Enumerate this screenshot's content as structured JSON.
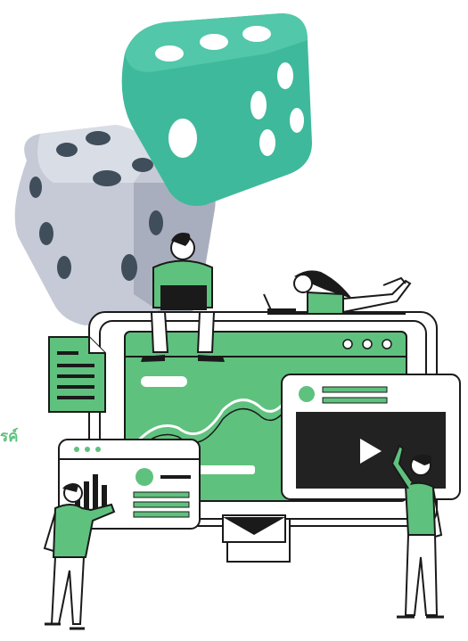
{
  "side_text": "รค์",
  "colors": {
    "accent_green": "#5fc17e",
    "teal_die": "#3fb99b",
    "grey_die": "#c5cad6",
    "dark": "#1a1a1a",
    "screen_dark": "#222222"
  },
  "icons": {
    "dice_1": "teal-die-icon",
    "dice_2": "grey-die-icon",
    "play": "play-icon",
    "mail": "mail-icon",
    "document": "document-icon",
    "chart": "bar-chart-icon"
  },
  "window_dots": 3
}
